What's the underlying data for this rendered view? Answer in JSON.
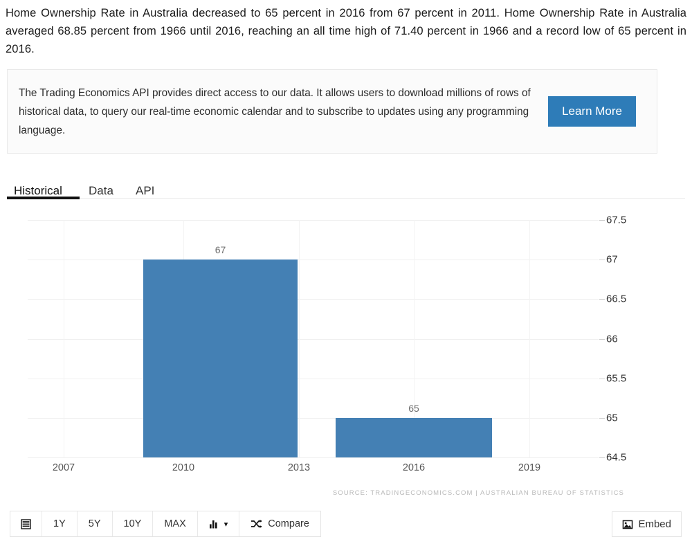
{
  "intro": {
    "text": "Home Ownership Rate in Australia decreased to 65 percent in 2016 from 67 percent in 2011. Home Ownership Rate in Australia averaged 68.85 percent from 1966 until 2016, reaching an all time high of 71.40 percent in 1966 and a record low of 65 percent in 2016."
  },
  "api_banner": {
    "text": "The Trading Economics API provides direct access to our data. It allows users to download millions of rows of historical data, to query our real-time economic calendar and to subscribe to updates using any programming language.",
    "button_label": "Learn More",
    "button_color": "#2e7cb8"
  },
  "tabs": {
    "items": [
      {
        "label": "Historical",
        "active": true,
        "x": 18
      },
      {
        "label": "Data",
        "active": false,
        "x": 126
      },
      {
        "label": "API",
        "active": false,
        "x": 194
      }
    ]
  },
  "chart_data": {
    "type": "bar",
    "title": "",
    "xlabel": "",
    "ylabel": "",
    "categories": [
      "2011",
      "2016"
    ],
    "values": [
      67,
      65
    ],
    "bar_labels": [
      "67",
      "65"
    ],
    "bar_color": "#4480b4",
    "ylim": [
      64.5,
      67.5
    ],
    "yticks": [
      67.5,
      67,
      66.5,
      66,
      65.5,
      65,
      64.5
    ],
    "ytick_labels": [
      "67.5",
      "67",
      "66.5",
      "66",
      "65.5",
      "65",
      "64.5"
    ],
    "xticks": [
      2007,
      2010,
      2013,
      2016,
      2019
    ],
    "xtick_labels": [
      "2007",
      "2010",
      "2013",
      "2016",
      "2019"
    ],
    "grid": true,
    "legend": false,
    "source": "SOURCE: TRADINGECONOMICS.COM  |  AUSTRALIAN BUREAU OF STATISTICS"
  },
  "toolbar": {
    "menu_icon": "list-icon",
    "ranges": [
      "1Y",
      "5Y",
      "10Y",
      "MAX"
    ],
    "chart_type_icon": "bar-chart-icon",
    "chart_type_caret": "▾",
    "compare_label": "Compare",
    "compare_icon": "shuffle-icon",
    "embed_label": "Embed",
    "embed_icon": "image-icon"
  }
}
